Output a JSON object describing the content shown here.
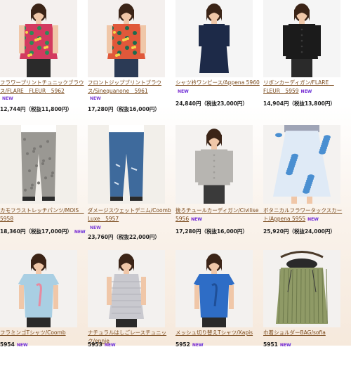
{
  "products": [
    {
      "name": "フラワープリントチュニックブラウス/FLARE　FLEUR　5962",
      "price": "12,744円（税抜11,800円）",
      "new": "NEW",
      "new_pos": "below",
      "colors": {
        "bg": "#f4f0ee",
        "garment": "#d33a5f",
        "accent": "#2e8b57",
        "pants": "#2a2a2a"
      },
      "pattern": "floral"
    },
    {
      "name": "フロントジップブリントブラウス/Sinequanone　5961",
      "price": "17,280円（税抜16,000円）",
      "new": "NEW",
      "new_pos": "below",
      "colors": {
        "bg": "#f4f0ee",
        "garment": "#e0583a",
        "accent": "#1f6b4e",
        "pants": "#2b3a55"
      },
      "pattern": "floral"
    },
    {
      "name": "シャツ衿ワンピース/Appena 5960",
      "price": "24,840円（税抜23,000円）",
      "new": "NEW",
      "new_pos": "inline",
      "colors": {
        "bg": "#f5f5f5",
        "garment": "#1d2a48",
        "accent": "#1d2a48",
        "pants": "#1d2a48"
      },
      "pattern": "dress"
    },
    {
      "name": "リボンカーディガン/FLARE　FLEUR　5959",
      "price": "14,904円（税抜13,800円）",
      "new": "NEW",
      "new_pos": "inline",
      "colors": {
        "bg": "#f5f5f5",
        "garment": "#1b1b1b",
        "accent": "#3a3a3a",
        "pants": "#2a2a2a"
      },
      "pattern": "knit"
    },
    {
      "name": "カモフラストレッチパンツ/MOIS　5958",
      "price": "18,360円（税抜17,000円）",
      "new": "NEW",
      "new_pos": "inline_price",
      "colors": {
        "bg": "#f2efea",
        "garment": "#9a9893",
        "accent": "#7a7874",
        "pants": "#a8a6a0"
      },
      "pattern": "pants"
    },
    {
      "name": "ダメージスウェットデニム/Coomb Luxe　5957",
      "price": "23,760円（税抜22,000円）",
      "new": "NEW",
      "new_pos": "below_name",
      "colors": {
        "bg": "#f2efea",
        "garment": "#3e6a9c",
        "accent": "#5d86b5",
        "pants": "#3e6a9c"
      },
      "pattern": "jeans"
    },
    {
      "name": "後ろチュールカーディガン/Civilise　5956",
      "price": "17,280円（税抜16,000円）",
      "new": "NEW",
      "new_pos": "inline",
      "colors": {
        "bg": "#f4f2f0",
        "garment": "#b7b5b1",
        "accent": "#9f9d99",
        "pants": "#3a3a3a"
      },
      "pattern": "cardigan"
    },
    {
      "name": "ボタニカルフラワータックスカート/Appena 5955",
      "price": "25,920円（税抜24,000円）",
      "new": "NEW",
      "new_pos": "inline",
      "colors": {
        "bg": "#f4f2f0",
        "garment": "#4a8fd1",
        "accent": "#dfeaf6",
        "pants": "#4a8fd1"
      },
      "pattern": "skirt"
    },
    {
      "name": "フラミンゴTシャツ/Coomb",
      "price": "5954",
      "new": "NEW",
      "new_pos": "price_inline",
      "colors": {
        "bg": "#f3f1ef",
        "garment": "#a9cfe3",
        "accent": "#e78aa0",
        "pants": "#2a2a2a"
      },
      "pattern": "tee"
    },
    {
      "name": "ナチュラルはしごレースチュニック/ennie",
      "price": "5953",
      "new": "NEW",
      "new_pos": "price_inline",
      "colors": {
        "bg": "#f3f1ef",
        "garment": "#c9c9cf",
        "accent": "#b1b1b8",
        "pants": "#2a2a2a"
      },
      "pattern": "tunic"
    },
    {
      "name": "メッシュ切り替えTシャツ/Xapis",
      "price": "5952",
      "new": "NEW",
      "new_pos": "price_inline",
      "colors": {
        "bg": "#f3f1ef",
        "garment": "#2e6dc6",
        "accent": "#1f4f98",
        "pants": "#2a2a2a"
      },
      "pattern": "tee"
    },
    {
      "name": "巾着ショルダーBAG/sofia",
      "price": "5951",
      "new": "NEW",
      "new_pos": "price_inline",
      "colors": {
        "bg": "#f3f1ef",
        "garment": "#8f9a66",
        "accent": "#6e7a4c",
        "pants": "#3a3a3a"
      },
      "pattern": "bag"
    }
  ]
}
